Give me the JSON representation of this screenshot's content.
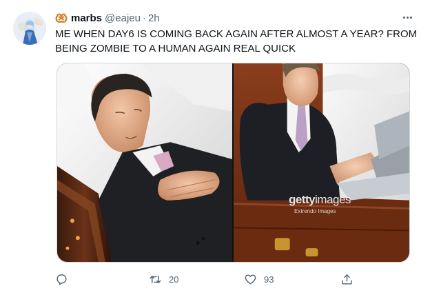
{
  "tweet": {
    "display_name": "marbs",
    "handle": "@eajeu",
    "separator": "·",
    "time": "2h",
    "text": "ME WHEN DAY6 IS COMING BACK AGAIN AFTER ALMOST A YEAR? FROM BEING ZOMBIE TO A HUMAN AGAIN REAL QUICK",
    "name_emoji": "pretzel-icon",
    "media": {
      "left_photo": "man-lying-in-coffin",
      "right_photo": "man-in-coffin-using-laptop",
      "watermark_brand": "getty",
      "watermark_brand_light": "images",
      "watermark_sub": "Extrendo Images"
    },
    "actions": {
      "reply_icon": "reply-icon",
      "retweet_icon": "retweet-icon",
      "retweet_count": "20",
      "like_icon": "heart-icon",
      "like_count": "93",
      "share_icon": "share-icon"
    }
  },
  "colors": {
    "text_primary": "#0f1419",
    "text_secondary": "#536471",
    "border": "#cfd9de",
    "background": "#ffffff"
  }
}
